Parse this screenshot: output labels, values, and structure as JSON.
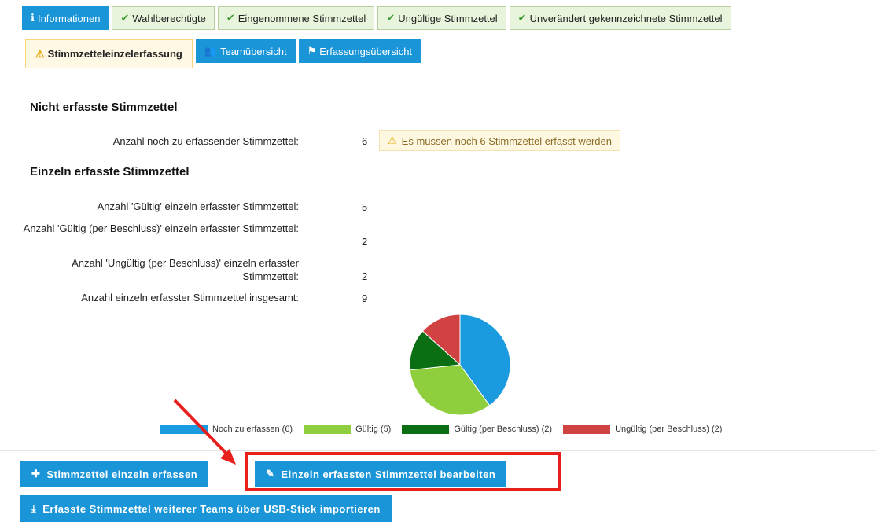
{
  "tabs_row1": [
    {
      "icon": "info-icon",
      "glyph": "ℹ",
      "label": "Informationen",
      "style": "blue"
    },
    {
      "icon": "check-circle-icon",
      "glyph": "✔",
      "label": "Wahlberechtigte",
      "style": "green"
    },
    {
      "icon": "check-circle-icon",
      "glyph": "✔",
      "label": "Eingenommene Stimmzettel",
      "style": "green"
    },
    {
      "icon": "check-circle-icon",
      "glyph": "✔",
      "label": "Ungültige Stimmzettel",
      "style": "green"
    },
    {
      "icon": "check-circle-icon",
      "glyph": "✔",
      "label": "Unverändert gekennzeichnete Stimmzettel",
      "style": "green"
    }
  ],
  "tabs_row2": [
    {
      "icon": "warning-icon",
      "glyph": "⚠",
      "label": "Stimmzetteleinzelerfassung",
      "style": "active"
    },
    {
      "icon": "team-icon",
      "glyph": "👥",
      "label": "Teamübersicht",
      "style": "blue"
    },
    {
      "icon": "flag-icon",
      "glyph": "⚑",
      "label": "Erfassungsübersicht",
      "style": "blue"
    }
  ],
  "section1": {
    "title": "Nicht erfasste Stimmzettel",
    "label": "Anzahl noch zu erfassender Stimmzettel:",
    "value": "6",
    "warning": "Es müssen noch 6 Stimmzettel erfasst werden"
  },
  "section2": {
    "title": "Einzeln erfasste Stimmzettel",
    "rows": [
      {
        "label": "Anzahl 'Gültig' einzeln erfasster Stimmzettel:",
        "value": "5"
      },
      {
        "label": "Anzahl 'Gültig (per Beschluss)' einzeln erfasster Stimmzettel:",
        "value": "2"
      },
      {
        "label": "Anzahl 'Ungültig (per Beschluss)' einzeln erfasster Stimmzettel:",
        "value": "2"
      },
      {
        "label": "Anzahl einzeln erfasster Stimmzettel insgesamt:",
        "value": "9"
      }
    ]
  },
  "chart_data": {
    "type": "pie",
    "categories": [
      "Noch zu erfassen (6)",
      "Gültig (5)",
      "Gültig (per Beschluss) (2)",
      "Ungültig (per Beschluss) (2)"
    ],
    "values": [
      6,
      5,
      2,
      2
    ],
    "colors": [
      "#1a9be0",
      "#8fce3c",
      "#0c6e12",
      "#d14343"
    ],
    "legend": "bottom",
    "title": "",
    "xlabel": "",
    "ylabel": ""
  },
  "buttons": {
    "add_single": "Stimmzettel einzeln erfassen",
    "edit_single": "Einzeln erfassten Stimmzettel bearbeiten",
    "import_usb": "Erfasste Stimmzettel weiterer Teams über USB-Stick importieren"
  },
  "colors": {
    "primary": "#1a95d8",
    "tab_green_bg": "#e9f4dc",
    "active_tab_bg": "#fff8e4",
    "highlight": "#e8201d"
  }
}
